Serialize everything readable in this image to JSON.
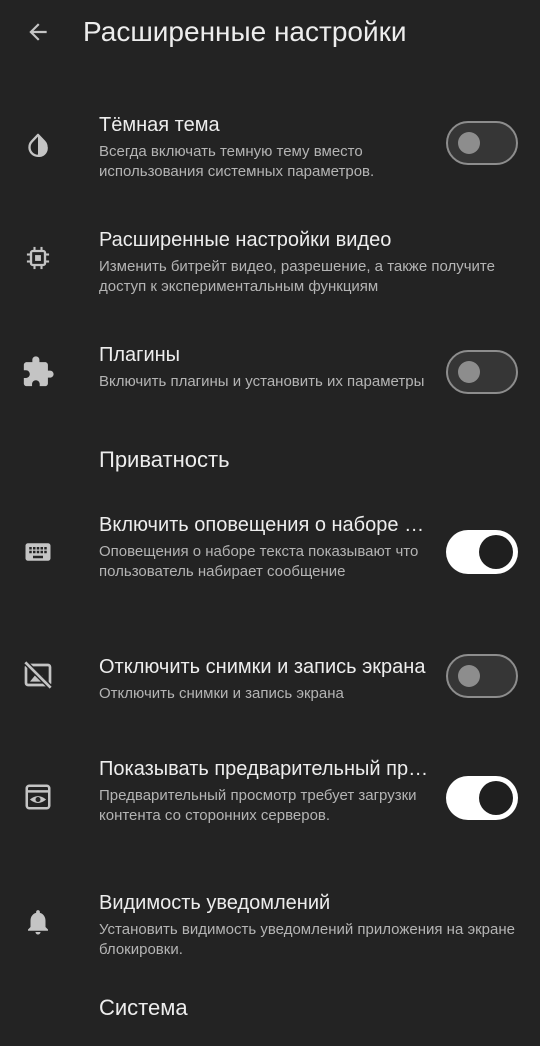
{
  "header": {
    "back_icon": "arrow-back-icon",
    "title": "Расширенные настройки"
  },
  "settings": [
    {
      "icon": "drop-icon",
      "title": "Тёмная тема",
      "summary": "Всегда включать темную тему вместо использования системных параметров.",
      "toggle": "off"
    },
    {
      "icon": "chip-icon",
      "title": "Расширенные настройки видео",
      "summary": "Изменить битрейт видео, разрешение, а также получите доступ к экспериментальным функциям"
    },
    {
      "icon": "puzzle-icon",
      "title": "Плагины",
      "summary": "Включить плагины и установить их параметры",
      "toggle": "off"
    }
  ],
  "sections": {
    "privacy": "Приватность",
    "system": "Система"
  },
  "privacy_settings": [
    {
      "icon": "keyboard-icon",
      "title": "Включить оповещения о наборе текста",
      "summary": "Оповещения о наборе текста показывают что пользователь набирает сообщение",
      "toggle": "on"
    },
    {
      "icon": "screenshot-off-icon",
      "title": "Отключить снимки и запись экрана",
      "summary": "Отключить снимки и запись экрана",
      "toggle": "off"
    },
    {
      "icon": "preview-icon",
      "title": "Показывать предварительный просмотр ссылок",
      "summary": "Предварительный просмотр требует загрузки контента со сторонних серверов.",
      "toggle": "on"
    },
    {
      "icon": "bell-icon",
      "title": "Видимость уведомлений",
      "summary": "Установить видимость уведомлений приложения на экране блокировки."
    }
  ],
  "colors": {
    "background": "#232323",
    "text_primary": "#ededed",
    "text_secondary": "#b4b4b4",
    "icon": "#c4c4c4",
    "switch_on_track": "#ffffff",
    "switch_off_track": "#363636",
    "switch_off_outline": "#8d8d8d"
  }
}
